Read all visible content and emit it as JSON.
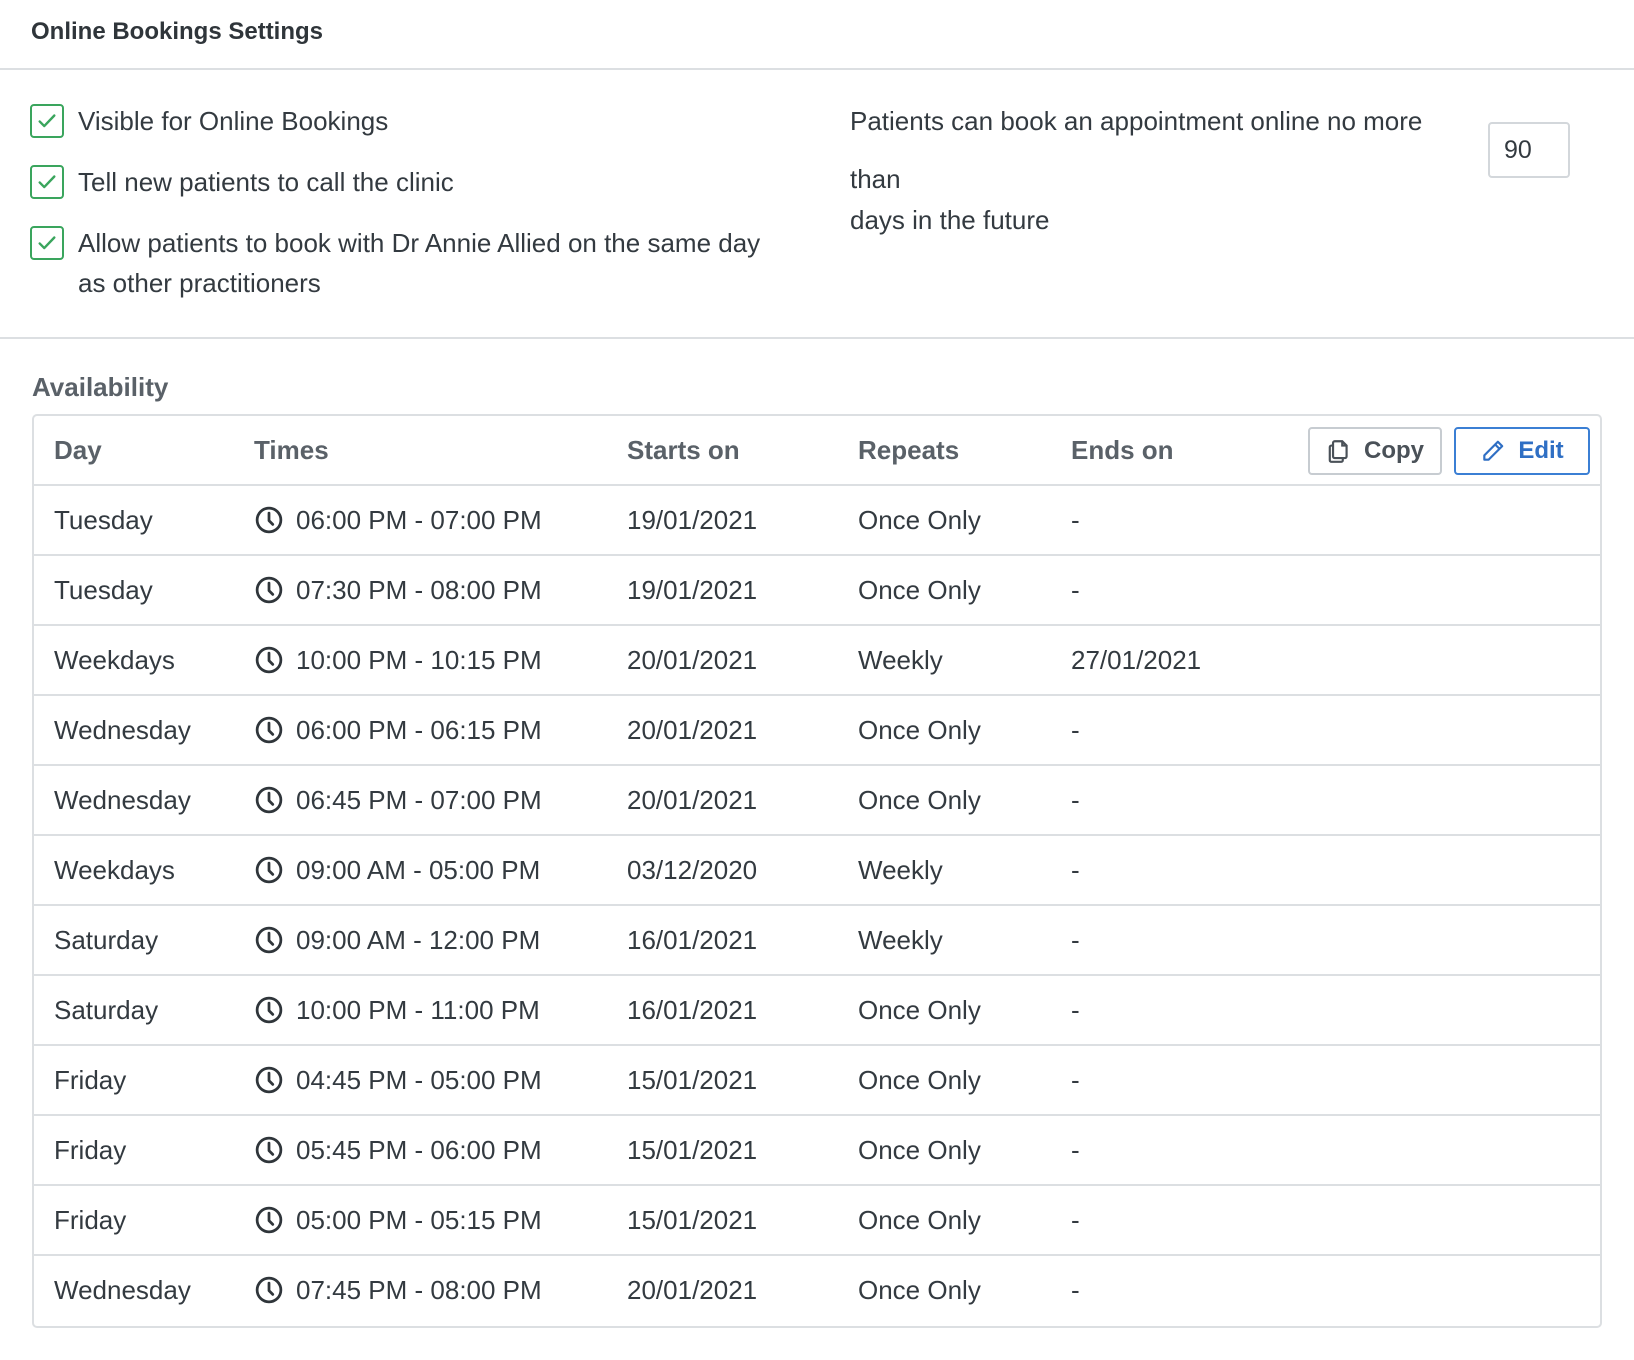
{
  "settings": {
    "title": "Online Bookings Settings",
    "checkboxes": [
      {
        "label": "Visible for Online Bookings",
        "checked": true
      },
      {
        "label": "Tell new patients to call the clinic",
        "checked": true
      },
      {
        "label": "Allow patients to book with Dr Annie Allied on the same day as other practitioners",
        "checked": true
      }
    ],
    "future_text_before": "Patients can book an appointment online no more than",
    "future_days_value": "90",
    "future_text_after": "days in the future"
  },
  "availability": {
    "title": "Availability",
    "headers": {
      "day": "Day",
      "times": "Times",
      "starts_on": "Starts on",
      "repeats": "Repeats",
      "ends_on": "Ends on"
    },
    "copy_label": "Copy",
    "edit_label": "Edit",
    "rows": [
      {
        "day": "Tuesday",
        "times": "06:00 PM - 07:00 PM",
        "starts_on": "19/01/2021",
        "repeats": "Once Only",
        "ends_on": "-"
      },
      {
        "day": "Tuesday",
        "times": "07:30 PM - 08:00 PM",
        "starts_on": "19/01/2021",
        "repeats": "Once Only",
        "ends_on": "-"
      },
      {
        "day": "Weekdays",
        "times": "10:00 PM - 10:15 PM",
        "starts_on": "20/01/2021",
        "repeats": "Weekly",
        "ends_on": "27/01/2021"
      },
      {
        "day": "Wednesday",
        "times": "06:00 PM - 06:15 PM",
        "starts_on": "20/01/2021",
        "repeats": "Once Only",
        "ends_on": "-"
      },
      {
        "day": "Wednesday",
        "times": "06:45 PM - 07:00 PM",
        "starts_on": "20/01/2021",
        "repeats": "Once Only",
        "ends_on": "-"
      },
      {
        "day": "Weekdays",
        "times": "09:00 AM - 05:00 PM",
        "starts_on": "03/12/2020",
        "repeats": "Weekly",
        "ends_on": "-"
      },
      {
        "day": "Saturday",
        "times": "09:00 AM - 12:00 PM",
        "starts_on": "16/01/2021",
        "repeats": "Weekly",
        "ends_on": "-"
      },
      {
        "day": "Saturday",
        "times": "10:00 PM - 11:00 PM",
        "starts_on": "16/01/2021",
        "repeats": "Once Only",
        "ends_on": "-"
      },
      {
        "day": "Friday",
        "times": "04:45 PM - 05:00 PM",
        "starts_on": "15/01/2021",
        "repeats": "Once Only",
        "ends_on": "-"
      },
      {
        "day": "Friday",
        "times": "05:45 PM - 06:00 PM",
        "starts_on": "15/01/2021",
        "repeats": "Once Only",
        "ends_on": "-"
      },
      {
        "day": "Friday",
        "times": "05:00 PM - 05:15 PM",
        "starts_on": "15/01/2021",
        "repeats": "Once Only",
        "ends_on": "-"
      },
      {
        "day": "Wednesday",
        "times": "07:45 PM - 08:00 PM",
        "starts_on": "20/01/2021",
        "repeats": "Once Only",
        "ends_on": "-"
      }
    ]
  },
  "icons": {
    "check": "check-icon",
    "clock": "clock-icon",
    "copy": "copy-icon",
    "edit": "pencil-icon"
  },
  "colors": {
    "checkbox_green": "#3aa55d",
    "edit_blue": "#3b7fd4"
  }
}
